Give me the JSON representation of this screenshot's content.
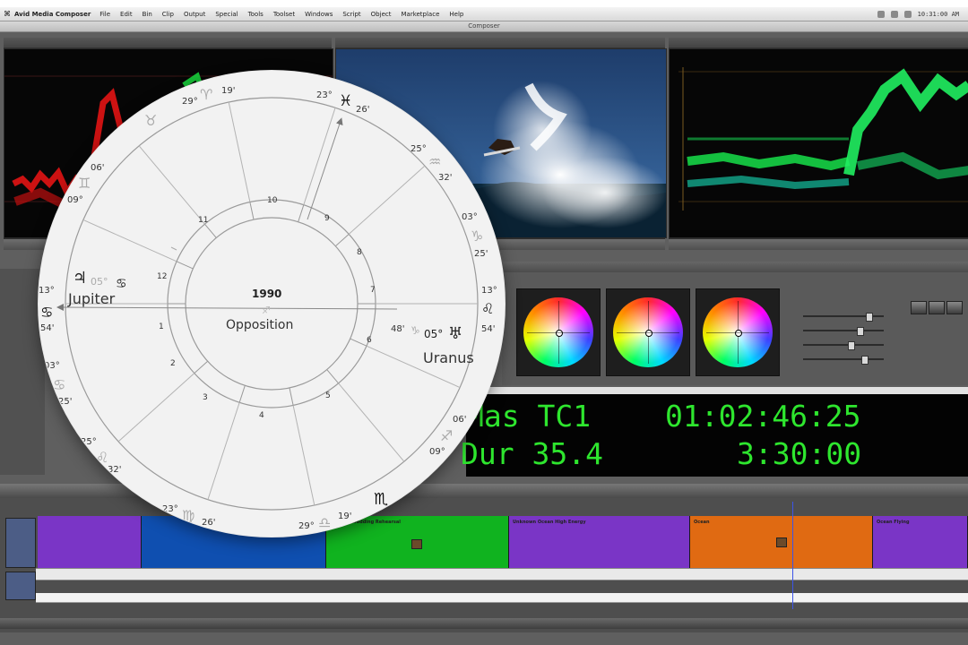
{
  "menubar": {
    "app_name": "Avid Media Composer",
    "menus": [
      "File",
      "Edit",
      "Bin",
      "Clip",
      "Output",
      "Special",
      "Tools",
      "Toolset",
      "Windows",
      "Script",
      "Object",
      "Marketplace",
      "Help"
    ],
    "clock": "10:31:00 AM"
  },
  "window": {
    "title": "Composer"
  },
  "timecode": {
    "row1_label": "Mas TC1",
    "row1_value": "01:02:46:25",
    "row2_label": "Dur 35.4",
    "row2_value": "3:30:00",
    "color": "#2ee62e"
  },
  "timeline": {
    "clips": [
      {
        "name": "",
        "color": "#7a35c6"
      },
      {
        "name": "",
        "color": "#0f4fb0"
      },
      {
        "name": "Another Wedding Rehearsal",
        "color": "#10b31f"
      },
      {
        "name": "Unknown Ocean High Energy",
        "color": "#7a35c6"
      },
      {
        "name": "Ocean",
        "color": "#e06a12"
      },
      {
        "name": "Ocean Flying",
        "color": "#7a35c6"
      }
    ],
    "playhead_color": "#3c55e8"
  },
  "astro_chart": {
    "center_year": "1990",
    "center_aspect": "Opposition",
    "planet_left": {
      "name": "Jupiter",
      "degree": "05°"
    },
    "planet_right": {
      "name": "Uranus",
      "degree": "05°",
      "minutes": "48'"
    },
    "houses": [
      "1",
      "2",
      "3",
      "4",
      "5",
      "6",
      "7",
      "8",
      "9",
      "10",
      "11",
      "12"
    ],
    "cusp_labels": [
      {
        "deg": "23°",
        "min": "26'"
      },
      {
        "deg": "25°",
        "min": "32'"
      },
      {
        "deg": "03°",
        "min": "25'"
      },
      {
        "deg": "13°",
        "min": "54'"
      },
      {
        "deg": "06'",
        "min": "09°"
      },
      {
        "deg": "29°",
        "min": "19'"
      },
      {
        "deg": "23°",
        "min": "26'"
      },
      {
        "deg": "25°",
        "min": "32'"
      },
      {
        "deg": "03°",
        "min": "25'"
      },
      {
        "deg": "13°",
        "min": "54'"
      },
      {
        "deg": "06'",
        "min": "09°"
      },
      {
        "deg": "29°",
        "min": "19'"
      }
    ],
    "glyphs": {
      "pisces": "♓",
      "virgo": "♍",
      "scorpio": "♏",
      "leo": "♌",
      "libra": "♎",
      "sagittarius": "♐",
      "aquarius": "♒",
      "taurus": "♉",
      "gemini": "♊",
      "cancer": "♋",
      "capricorn": "♑",
      "aries": "♈",
      "jupiter": "♃",
      "uranus": "♅",
      "saturn": "♄",
      "moon_node": "☊",
      "arrow": "↗"
    }
  }
}
